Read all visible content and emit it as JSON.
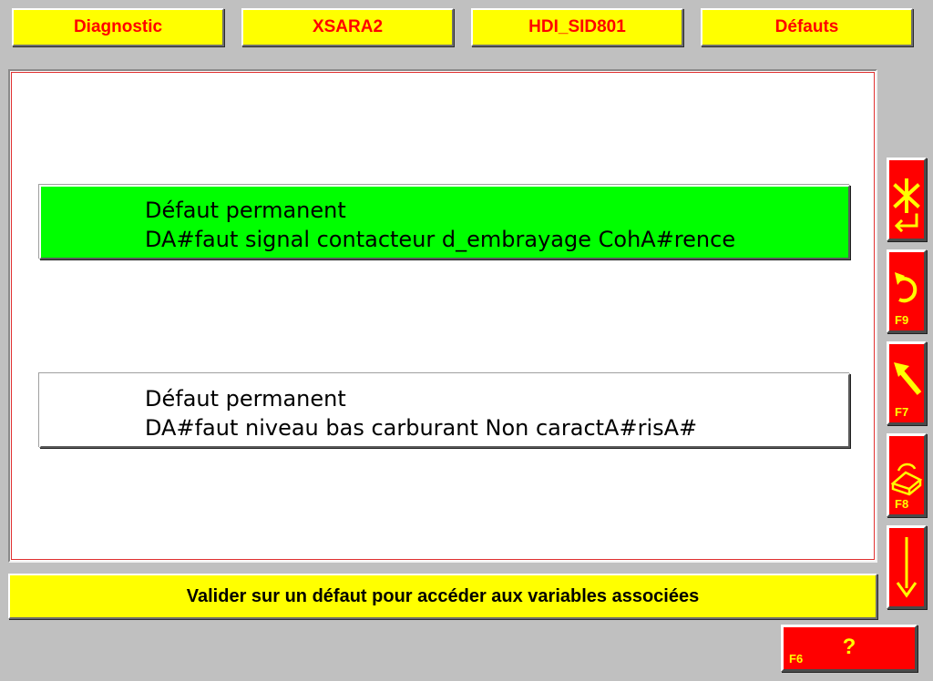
{
  "header": {
    "tabs": [
      {
        "label": "Diagnostic"
      },
      {
        "label": "XSARA2"
      },
      {
        "label": "HDI_SID801"
      },
      {
        "label": "Défauts"
      }
    ]
  },
  "faults": [
    {
      "status": "Défaut permanent",
      "description": "DA#faut signal contacteur d_embrayage CohA#rence",
      "selected": true
    },
    {
      "status": "Défaut permanent",
      "description": "DA#faut niveau bas carburant Non caractA#risA#",
      "selected": false
    }
  ],
  "status_bar": {
    "message": "Valider sur un défaut pour accéder aux variables associées"
  },
  "side_buttons": [
    {
      "icon": "cancel-enter-icon",
      "key": ""
    },
    {
      "icon": "refresh-icon",
      "key": "F9"
    },
    {
      "icon": "arrow-up-left-icon",
      "key": "F7"
    },
    {
      "icon": "eraser-icon",
      "key": "F8"
    },
    {
      "icon": "arrow-down-icon",
      "key": ""
    }
  ],
  "help_button": {
    "key": "F6",
    "symbol": "?"
  },
  "colors": {
    "background": "#c0c0c0",
    "tab_background": "#ffff00",
    "tab_text": "#ff0000",
    "selected_row": "#00ff00",
    "button_red": "#ff0000",
    "button_glyph": "#ffff00"
  }
}
